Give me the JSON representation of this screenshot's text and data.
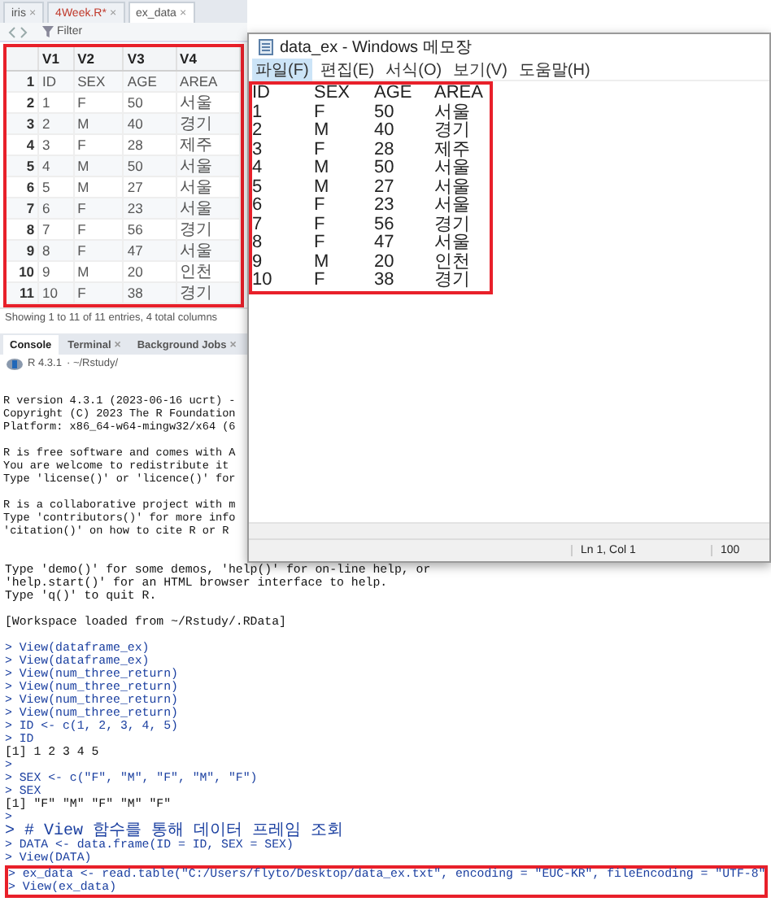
{
  "editor_tabs": [
    {
      "label": "iris",
      "close": "×",
      "selected": false,
      "modified": false
    },
    {
      "label": "4Week.R*",
      "close": "×",
      "selected": false,
      "modified": true
    },
    {
      "label": "ex_data",
      "close": "×",
      "selected": true,
      "modified": false
    }
  ],
  "toolbar": {
    "filter": "Filter"
  },
  "data_view": {
    "columns": [
      "",
      "V1",
      "V2",
      "V3",
      "V4"
    ],
    "rows": [
      [
        "1",
        "ID",
        "SEX",
        "AGE",
        "AREA"
      ],
      [
        "2",
        "1",
        "F",
        "50",
        "서울"
      ],
      [
        "3",
        "2",
        "M",
        "40",
        "경기"
      ],
      [
        "4",
        "3",
        "F",
        "28",
        "제주"
      ],
      [
        "5",
        "4",
        "M",
        "50",
        "서울"
      ],
      [
        "6",
        "5",
        "M",
        "27",
        "서울"
      ],
      [
        "7",
        "6",
        "F",
        "23",
        "서울"
      ],
      [
        "8",
        "7",
        "F",
        "56",
        "경기"
      ],
      [
        "9",
        "8",
        "F",
        "47",
        "서울"
      ],
      [
        "10",
        "9",
        "M",
        "20",
        "인천"
      ],
      [
        "11",
        "10",
        "F",
        "38",
        "경기"
      ]
    ],
    "footer": "Showing 1 to 11 of 11 entries, 4 total columns"
  },
  "console_tabs": [
    {
      "label": "Console",
      "selected": true
    },
    {
      "label": "Terminal",
      "close": "×",
      "selected": false
    },
    {
      "label": "Background Jobs",
      "close": "×",
      "selected": false
    }
  ],
  "console_path": {
    "version": "R 4.3.1",
    "path": "· ~/Rstudy/"
  },
  "console_blocks_beside_notepad": [
    [
      {
        "kind": "output",
        "text": "R version 4.3.1 (2023-06-16 ucrt) -"
      },
      {
        "kind": "output",
        "text": "Copyright (C) 2023 The R Foundation"
      },
      {
        "kind": "output",
        "text": "Platform: x86_64-w64-mingw32/x64 (6"
      }
    ],
    [
      {
        "kind": "output",
        "text": "R is free software and comes with A"
      },
      {
        "kind": "output",
        "text": "You are welcome to redistribute it"
      },
      {
        "kind": "output",
        "text": "Type 'license()' or 'licence()' for"
      }
    ],
    [
      {
        "kind": "output",
        "text": "R is a collaborative project with m"
      },
      {
        "kind": "output",
        "text": "Type 'contributors()' for more info"
      },
      {
        "kind": "output",
        "text": "'citation()' on how to cite R or R"
      }
    ]
  ],
  "console_blocks": [
    [
      {
        "kind": "output",
        "text": "Type 'demo()' for some demos, 'help()' for on-line help, or"
      },
      {
        "kind": "output",
        "text": "'help.start()' for an HTML browser interface to help."
      },
      {
        "kind": "output",
        "text": "Type 'q()' to quit R."
      }
    ],
    [
      {
        "kind": "output",
        "text": "[Workspace loaded from ~/Rstudy/.RData]"
      }
    ],
    [
      {
        "kind": "input",
        "text": "> View(dataframe_ex)"
      },
      {
        "kind": "input",
        "text": "> View(dataframe_ex)"
      },
      {
        "kind": "input",
        "text": "> View(num_three_return)"
      },
      {
        "kind": "input",
        "text": "> View(num_three_return)"
      },
      {
        "kind": "input",
        "text": "> View(num_three_return)"
      },
      {
        "kind": "input",
        "text": "> View(num_three_return)"
      },
      {
        "kind": "input",
        "text": "> ID <- c(1, 2, 3, 4, 5)"
      },
      {
        "kind": "input",
        "text": "> ID"
      },
      {
        "kind": "output",
        "text": "[1] 1 2 3 4 5"
      },
      {
        "kind": "input",
        "text": ">"
      },
      {
        "kind": "input",
        "text": "> SEX <- c(\"F\", \"M\", \"F\", \"M\", \"F\")"
      },
      {
        "kind": "input",
        "text": "> SEX"
      },
      {
        "kind": "output",
        "text": "[1] \"F\" \"M\" \"F\" \"M\" \"F\""
      },
      {
        "kind": "input",
        "text": ">"
      },
      {
        "kind": "comment",
        "text": "> # View 함수를 통해 데이터 프레임 조회"
      },
      {
        "kind": "input",
        "text": "> DATA <- data.frame(ID = ID, SEX = SEX)"
      },
      {
        "kind": "input",
        "text": "> View(DATA)"
      }
    ]
  ],
  "highlighted_lines": [
    {
      "kind": "input",
      "text": "> ex_data <- read.table(\"C:/Users/flyto/Desktop/data_ex.txt\", encoding = \"EUC-KR\", fileEncoding = \"UTF-8\""
    },
    {
      "kind": "input",
      "text": "> View(ex_data)"
    }
  ],
  "notepad": {
    "title": "data_ex - Windows 메모장",
    "menu": [
      {
        "label": "파일(F)",
        "selected": true
      },
      {
        "label": "편집(E)",
        "selected": false
      },
      {
        "label": "서식(O)",
        "selected": false
      },
      {
        "label": "보기(V)",
        "selected": false
      },
      {
        "label": "도움말(H)",
        "selected": false
      }
    ],
    "lines": [
      [
        "ID",
        "SEX",
        "AGE",
        "AREA"
      ],
      [
        "1",
        "F",
        "50",
        "서울"
      ],
      [
        "2",
        "M",
        "40",
        "경기"
      ],
      [
        "3",
        "F",
        "28",
        "제주"
      ],
      [
        "4",
        "M",
        "50",
        "서울"
      ],
      [
        "5",
        "M",
        "27",
        "서울"
      ],
      [
        "6",
        "F",
        "23",
        "서울"
      ],
      [
        "7",
        "F",
        "56",
        "경기"
      ],
      [
        "8",
        "F",
        "47",
        "서울"
      ],
      [
        "9",
        "M",
        "20",
        "인천"
      ],
      [
        "10",
        "F",
        "38",
        "경기"
      ]
    ],
    "status": {
      "position": "Ln 1, Col 1",
      "zoom": "100"
    }
  }
}
